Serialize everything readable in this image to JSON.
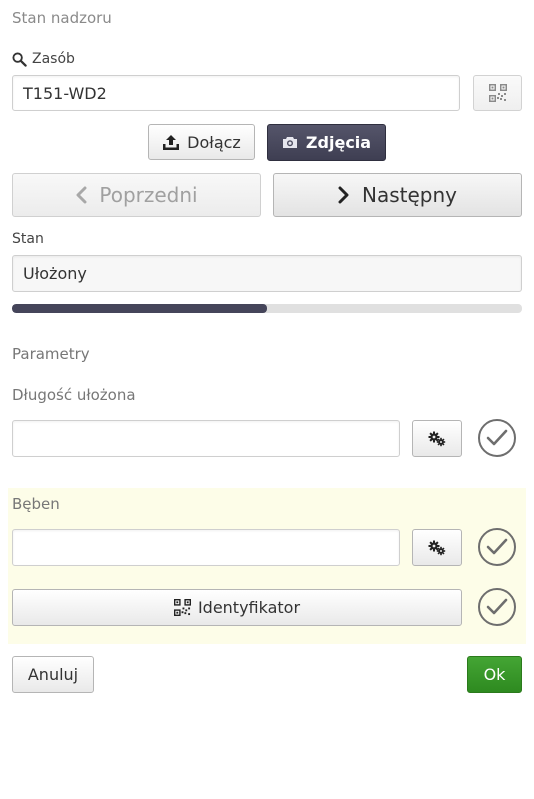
{
  "header": {
    "title": "Stan nadzoru"
  },
  "resource": {
    "label": "Zasób",
    "value": "T151-WD2",
    "qr_icon": "qr-code-icon"
  },
  "actions": {
    "attach_label": "Dołącz",
    "photos_label": "Zdjęcia"
  },
  "navigation": {
    "prev_label": "Poprzedni",
    "next_label": "Następny"
  },
  "state": {
    "label": "Stan",
    "value": "Ułożony",
    "progress_fraction": 0.5
  },
  "parameters": {
    "title": "Parametry",
    "length": {
      "label": "Długość ułożona",
      "value": ""
    },
    "drum": {
      "label": "Bęben",
      "value": "",
      "identifier_label": "Identyfikator"
    }
  },
  "footer": {
    "cancel_label": "Anuluj",
    "ok_label": "Ok"
  },
  "colors": {
    "accent_dark": "#45455a",
    "ok_green": "#37972a",
    "highlight_bg": "#fdfde8"
  }
}
